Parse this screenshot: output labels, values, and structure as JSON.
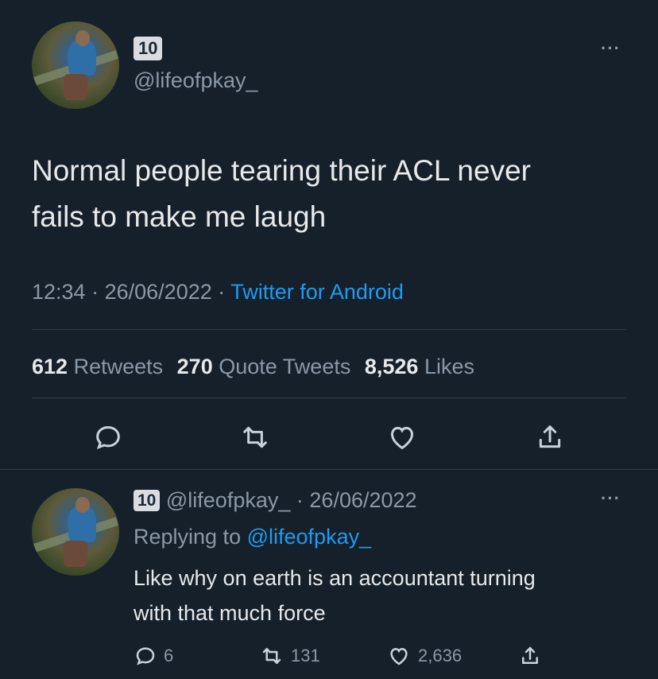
{
  "main_tweet": {
    "badge": "10",
    "handle": "@lifeofpkay_",
    "text_line1": "Normal people tearing their ACL never",
    "text_line2": "fails to make me laugh",
    "time": "12:34",
    "date": "26/06/2022",
    "separator": "·",
    "source": "Twitter for Android",
    "stats": {
      "retweets_count": "612",
      "retweets_label": "Retweets",
      "quotes_count": "270",
      "quotes_label": "Quote Tweets",
      "likes_count": "8,526",
      "likes_label": "Likes"
    },
    "more": "···"
  },
  "reply_tweet": {
    "badge": "10",
    "handle": "@lifeofpkay_",
    "separator": "·",
    "date": "26/06/2022",
    "replying_label": "Replying to",
    "replying_handle": "@lifeofpkay_",
    "text_line1": "Like why on earth is an accountant turning",
    "text_line2": "with that much force",
    "actions": {
      "reply_count": "6",
      "retweet_count": "131",
      "like_count": "2,636"
    },
    "more": "···"
  },
  "icons": {
    "reply": "reply-icon",
    "retweet": "retweet-icon",
    "like": "heart-icon",
    "share": "share-icon"
  },
  "colors": {
    "background": "#15202b",
    "link": "#1d9bf0",
    "muted": "#8b98a5"
  }
}
